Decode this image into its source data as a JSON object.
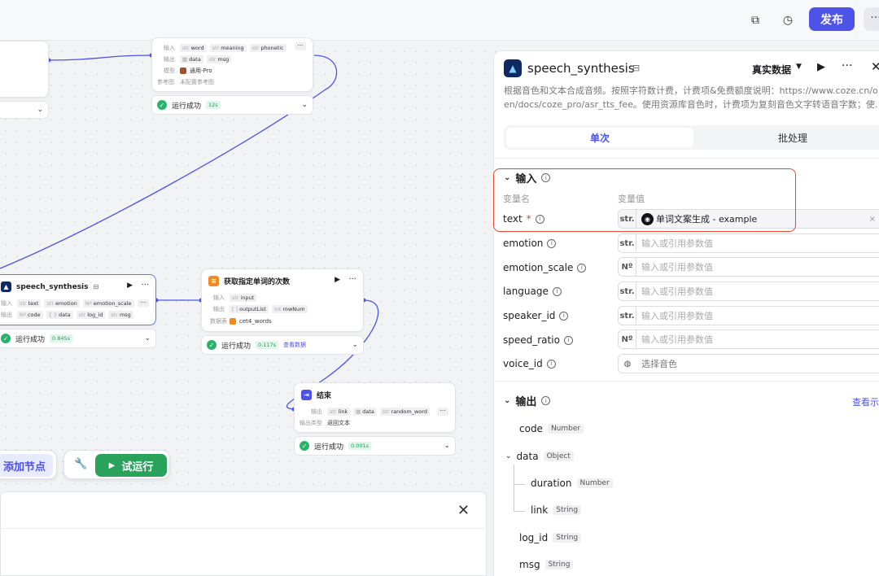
{
  "topbar": {
    "publish_label": "发布"
  },
  "canvas": {
    "nodes": {
      "top_llm": {
        "input_label": "输入",
        "output_label": "输出",
        "model_label": "模型",
        "ref_label": "参考图",
        "inputs": [
          {
            "t": "str",
            "n": "word"
          },
          {
            "t": "str",
            "n": "meaning"
          },
          {
            "t": "str",
            "n": "phonetic"
          }
        ],
        "outputs": [
          {
            "t": "img",
            "n": "data"
          },
          {
            "t": "str",
            "n": "msg"
          }
        ],
        "model": "通用-Pro",
        "ref_value": "未配置参考图",
        "status": "运行成功",
        "time": "12s"
      },
      "speech": {
        "title": "speech_synthesis",
        "input_label": "输入",
        "output_label": "输出",
        "inputs": [
          {
            "t": "str",
            "n": "text"
          },
          {
            "t": "str",
            "n": "emotion"
          },
          {
            "t": "Nº",
            "n": "emotion_scale"
          }
        ],
        "outputs": [
          {
            "t": "Nº",
            "n": "code"
          },
          {
            "t": "{}",
            "n": "data"
          },
          {
            "t": "str",
            "n": "log_id"
          },
          {
            "t": "str",
            "n": "msg"
          }
        ],
        "status": "运行成功",
        "time": "0.845s"
      },
      "db": {
        "title": "获取指定单词的次数",
        "input_label": "输入",
        "output_label": "输出",
        "db_label": "数据表",
        "inputs": [
          {
            "t": "str",
            "n": "input"
          }
        ],
        "outputs": [
          {
            "t": "[ ]",
            "n": "outputList"
          },
          {
            "t": "int",
            "n": "rowNum"
          }
        ],
        "db_value": "cet4_words",
        "status": "运行成功",
        "time": "0.117s",
        "view_label": "查看数据"
      },
      "end": {
        "title": "结束",
        "output_label": "输出",
        "output_type_label": "输出类型",
        "outputs": [
          {
            "t": "str",
            "n": "link"
          },
          {
            "t": "img",
            "n": "data"
          },
          {
            "t": "str",
            "n": "random_word"
          }
        ],
        "output_type": "返回文本",
        "status": "运行成功",
        "time": "0.001s"
      }
    },
    "add_node_label": "添加节点",
    "test_run_label": "试运行"
  },
  "panel": {
    "title": "speech_synthesis",
    "mode": "真实数据",
    "description_line1": "根据音色和文本合成音频。按照字符数计费，计费项&免费额度说明：https://www.coze.cn/o",
    "description_line2": "en/docs/coze_pro/asr_tts_fee。使用资源库音色时，计费项为复刻音色文字转语音字数；使.",
    "tabs": [
      "单次",
      "批处理"
    ],
    "input_section": "输入",
    "col_name": "变量名",
    "col_value": "变量值",
    "params": [
      {
        "name": "text",
        "required": true,
        "type": "str.",
        "value": "单词文案生成 - example",
        "filled": true
      },
      {
        "name": "emotion",
        "type": "str.",
        "placeholder": "输入或引用参数值"
      },
      {
        "name": "emotion_scale",
        "type": "Nº",
        "placeholder": "输入或引用参数值"
      },
      {
        "name": "language",
        "type": "str.",
        "placeholder": "输入或引用参数值"
      },
      {
        "name": "speaker_id",
        "type": "str.",
        "placeholder": "输入或引用参数值"
      },
      {
        "name": "speed_ratio",
        "type": "Nº",
        "placeholder": "输入或引用参数值"
      },
      {
        "name": "voice_id",
        "type": "voice",
        "placeholder": "选择音色"
      }
    ],
    "output_section": "输出",
    "view_example": "查看示",
    "outputs": [
      {
        "name": "code",
        "type": "Number"
      },
      {
        "name": "data",
        "type": "Object"
      },
      {
        "name": "duration",
        "type": "Number"
      },
      {
        "name": "link",
        "type": "String"
      },
      {
        "name": "log_id",
        "type": "String"
      },
      {
        "name": "msg",
        "type": "String"
      }
    ]
  },
  "colors": {
    "accent": "#4d53e8",
    "success": "#29b36a",
    "highlight": "#e5482f"
  }
}
